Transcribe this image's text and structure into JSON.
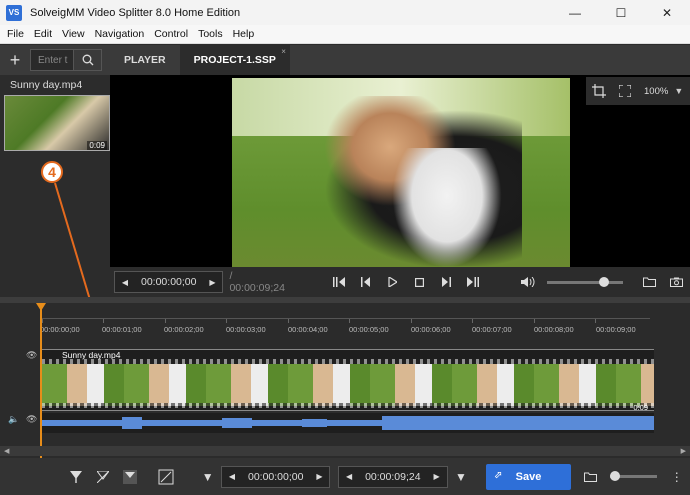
{
  "window": {
    "title": "SolveigMM Video Splitter 8.0 Home Edition",
    "icon_label": "VS",
    "controls": {
      "minimize": "—",
      "maximize": "☐",
      "close": "✕"
    }
  },
  "menu": [
    "File",
    "Edit",
    "View",
    "Navigation",
    "Control",
    "Tools",
    "Help"
  ],
  "left_toolbar": {
    "add_label": "+",
    "search_placeholder": "Enter t"
  },
  "tabs": [
    {
      "label": "PLAYER",
      "active": false
    },
    {
      "label": "PROJECT-1.SSP",
      "active": true,
      "close": "×"
    }
  ],
  "media": {
    "filename": "Sunny day.mp4",
    "thumb_duration": "0:09"
  },
  "annotation": {
    "number": "4",
    "color": "#e46a1e"
  },
  "viewer": {
    "zoom": "100%",
    "zoom_arrow": "▼"
  },
  "player": {
    "current_tc": "00:00:00;00",
    "total_tc": "/ 00:00:09;24",
    "prev_arrow": "◀",
    "next_arrow": "▶"
  },
  "timeline": {
    "ticks": [
      "00:00:00;00",
      "00:00:01;00",
      "00:00:02;00",
      "00:00:03;00",
      "00:00:04;00",
      "00:00:05;00",
      "00:00:06;00",
      "00:00:07;00",
      "00:00:08;00",
      "00:00:09;00"
    ],
    "clip_name": "Sunny day.mp4",
    "clip_duration": "0:09",
    "playhead_color": "#e78d1a"
  },
  "bottom": {
    "start_tc": "00:00:00;00",
    "end_tc": "00:00:09;24",
    "save_label": "Save",
    "accent": "#2e6fd8"
  }
}
